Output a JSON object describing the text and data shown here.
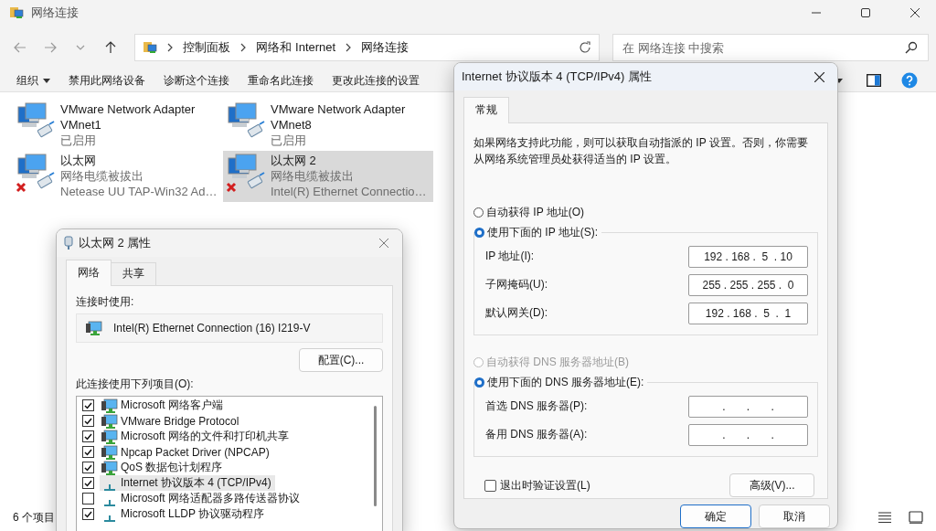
{
  "explorer": {
    "title": "网络连接",
    "breadcrumb": [
      "控制面板",
      "网络和 Internet",
      "网络连接"
    ],
    "search": {
      "placeholder": "在 网络连接 中搜索"
    },
    "commands": [
      {
        "label": "组织",
        "menu": true
      },
      {
        "label": "禁用此网络设备",
        "menu": false
      },
      {
        "label": "诊断这个连接",
        "menu": false
      },
      {
        "label": "重命名此连接",
        "menu": false
      },
      {
        "label": "更改此连接的设置",
        "menu": false
      }
    ],
    "adapters": [
      {
        "name": "VMware Network Adapter VMnet1",
        "status": "已启用",
        "connected": true,
        "selected": false
      },
      {
        "name": "VMware Network Adapter VMnet8",
        "status": "已启用",
        "connected": true,
        "selected": false
      },
      {
        "name": "以太网",
        "status": "网络电缆被拔出",
        "device": "Netease UU TAP-Win32 Ad…",
        "connected": false,
        "selected": false
      },
      {
        "name": "以太网 2",
        "status": "网络电缆被拔出",
        "device": "Intel(R) Ethernet Connectio…",
        "connected": false,
        "selected": true
      }
    ],
    "status_bar": {
      "item_count": "6 个项目"
    }
  },
  "ethernet_dialog": {
    "title": "以太网 2 属性",
    "tabs": [
      {
        "label": "网络",
        "selected": true
      },
      {
        "label": "共享",
        "selected": false
      }
    ],
    "connect_using_label": "连接时使用:",
    "adapter": "Intel(R) Ethernet Connection (16) I219-V",
    "configure_button": "配置(C)...",
    "items_label": "此连接使用下列项目(O):",
    "items": [
      {
        "label": "Microsoft 网络客户端",
        "kind": "service",
        "checked": true,
        "selected": false
      },
      {
        "label": "VMware Bridge Protocol",
        "kind": "service",
        "checked": true,
        "selected": false
      },
      {
        "label": "Microsoft 网络的文件和打印机共享",
        "kind": "service",
        "checked": true,
        "selected": false
      },
      {
        "label": "Npcap Packet Driver (NPCAP)",
        "kind": "service",
        "checked": true,
        "selected": false
      },
      {
        "label": "QoS 数据包计划程序",
        "kind": "service",
        "checked": true,
        "selected": false
      },
      {
        "label": "Internet 协议版本 4 (TCP/IPv4)",
        "kind": "protocol",
        "checked": true,
        "selected": true
      },
      {
        "label": "Microsoft 网络适配器多路传送器协议",
        "kind": "protocol",
        "checked": false,
        "selected": false
      },
      {
        "label": "Microsoft LLDP 协议驱动程序",
        "kind": "protocol",
        "checked": true,
        "selected": false
      }
    ]
  },
  "ipv4_dialog": {
    "title": "Internet 协议版本 4 (TCP/IPv4) 属性",
    "tabs": [
      {
        "label": "常规",
        "selected": true
      }
    ],
    "description": "如果网络支持此功能，则可以获取自动指派的 IP 设置。否则，你需要从网络系统管理员处获得适当的 IP 设置。",
    "ip_mode": [
      {
        "label": "自动获得 IP 地址(O)",
        "selected": false,
        "disabled": false
      },
      {
        "label": "使用下面的 IP 地址(S):",
        "selected": true,
        "disabled": false
      }
    ],
    "ip_fields": [
      {
        "label": "IP 地址(I):",
        "value": "192 . 168 .  5  . 10"
      },
      {
        "label": "子网掩码(U):",
        "value": "255 . 255 . 255 .  0"
      },
      {
        "label": "默认网关(D):",
        "value": "192 . 168 .  5  .  1"
      }
    ],
    "dns_mode": [
      {
        "label": "自动获得 DNS 服务器地址(B)",
        "selected": false,
        "disabled": true
      },
      {
        "label": "使用下面的 DNS 服务器地址(E):",
        "selected": true,
        "disabled": false
      }
    ],
    "dns_fields": [
      {
        "label": "首选 DNS 服务器(P):",
        "value": ".       .       ."
      },
      {
        "label": "备用 DNS 服务器(A):",
        "value": ".       .       ."
      }
    ],
    "validate_on_exit": {
      "label": "退出时验证设置(L)",
      "checked": false
    },
    "advanced_button": "高级(V)...",
    "buttons": [
      {
        "label": "确定",
        "default": true
      },
      {
        "label": "取消",
        "default": false
      }
    ]
  }
}
